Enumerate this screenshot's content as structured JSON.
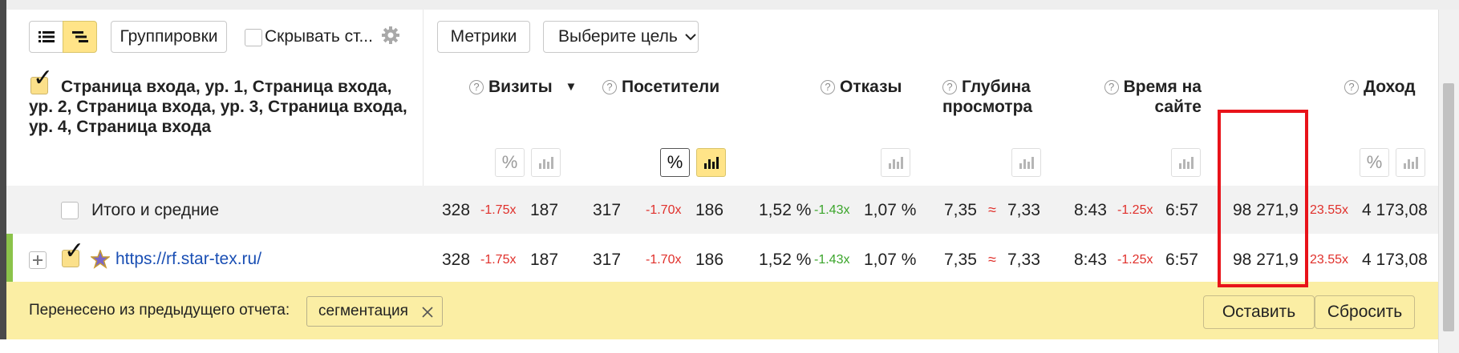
{
  "toolbar": {
    "grouping_label": "Группировки",
    "hide_label": "Скрывать ст...",
    "metrics_label": "Метрики",
    "goal_label": "Выберите цель"
  },
  "icons": {
    "list_view": "list-icon",
    "tree_view": "tree-list-icon",
    "settings": "gear-icon",
    "help": "question-circle-icon",
    "chevron": "chevron-down-icon",
    "sort": "sort-down-triangle-icon",
    "percent": "percent-icon",
    "bars": "bar-chart-icon",
    "expand": "plus-square-icon",
    "favicon": "star-icon",
    "close": "close-icon"
  },
  "header": {
    "dimension_label": "Страница входа, ур. 1, Страница входа, ур. 2, Страница входа, ур. 3, Страница входа, ур. 4, Страница входа",
    "sort_indicator": "▼",
    "columns": [
      {
        "label": "Визиты"
      },
      {
        "label": "Посетители"
      },
      {
        "label": "Отказы"
      },
      {
        "label": "Глубина просмотра"
      },
      {
        "label": "Время на сайте"
      },
      {
        "label": "Доход"
      }
    ]
  },
  "rows": [
    {
      "label": "Итого и средние",
      "cells": [
        {
          "a": "328",
          "r": "-1.75x",
          "b": "187"
        },
        {
          "a": "317",
          "r": "-1.70x",
          "b": "186"
        },
        {
          "a": "1,52 %",
          "r": "-1.43x",
          "b": "1,07 %"
        },
        {
          "a": "7,35",
          "r": "≈",
          "b": "7,33"
        },
        {
          "a": "8:43",
          "r": "-1.25x",
          "b": "6:57"
        },
        {
          "a": "98 271,9",
          "r": "23.55x",
          "b": "4 173,08"
        }
      ]
    },
    {
      "label": "https://rf.star-tex.ru/",
      "cells": [
        {
          "a": "328",
          "r": "-1.75x",
          "b": "187"
        },
        {
          "a": "317",
          "r": "-1.70x",
          "b": "186"
        },
        {
          "a": "1,52 %",
          "r": "-1.43x",
          "b": "1,07 %"
        },
        {
          "a": "7,35",
          "r": "≈",
          "b": "7,33"
        },
        {
          "a": "8:43",
          "r": "-1.25x",
          "b": "6:57"
        },
        {
          "a": "98 271,9",
          "r": "23.55x",
          "b": "4 173,08"
        }
      ]
    }
  ],
  "bottom": {
    "carried_label": "Перенесено из предыдущего отчета:",
    "tag_label": "сегментация",
    "keep_label": "Оставить",
    "reset_label": "Сбросить"
  },
  "colors": {
    "accent_yellow": "#ffe488",
    "bar_yellow": "#fbeea4",
    "ratio_red": "#e0302b",
    "ratio_green": "#3ba52b",
    "highlight_red": "#e8131a"
  }
}
